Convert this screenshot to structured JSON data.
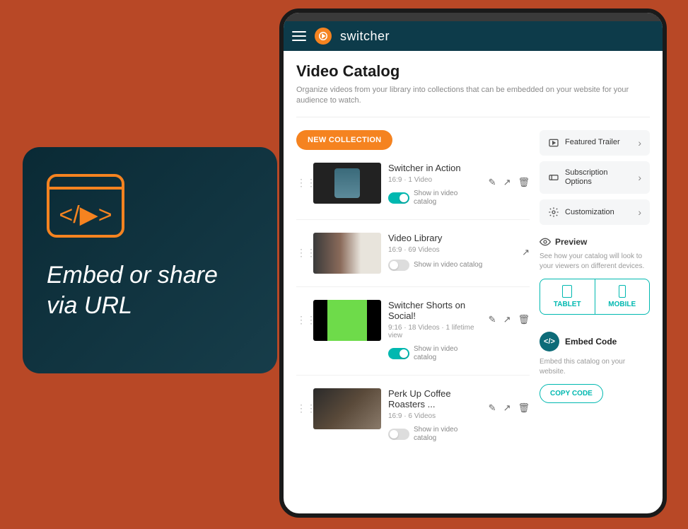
{
  "promo": {
    "text": "Embed or share via URL"
  },
  "brand": "switcher",
  "page": {
    "title": "Video Catalog",
    "subtitle": "Organize videos from your library into collections that can be embedded on your website for your audience to watch."
  },
  "newCollectionLabel": "NEW COLLECTION",
  "toggleLabel": "Show in video catalog",
  "collections": [
    {
      "title": "Switcher in Action",
      "meta": "16:9  ·  1 Video",
      "on": true,
      "actions": [
        "edit",
        "share",
        "delete"
      ]
    },
    {
      "title": "Video Library",
      "meta": "16:9  ·  69 Videos",
      "on": false,
      "actions": [
        "share"
      ]
    },
    {
      "title": "Switcher Shorts on Social!",
      "meta": "9:16  ·  18 Videos  ·  1 lifetime view",
      "on": true,
      "actions": [
        "edit",
        "share",
        "delete"
      ]
    },
    {
      "title": "Perk Up Coffee Roasters ...",
      "meta": "16:9  ·  6 Videos",
      "on": false,
      "actions": [
        "edit",
        "share",
        "delete"
      ]
    }
  ],
  "sidebar": {
    "items": [
      {
        "label": "Featured Trailer"
      },
      {
        "label": "Subscription Options"
      },
      {
        "label": "Customization"
      }
    ],
    "preview": {
      "title": "Preview",
      "sub": "See how your catalog will look to your viewers on different devices.",
      "tablet": "TABLET",
      "mobile": "MOBILE"
    },
    "embed": {
      "title": "Embed Code",
      "sub": "Embed this catalog on your website.",
      "copy": "COPY CODE"
    }
  }
}
